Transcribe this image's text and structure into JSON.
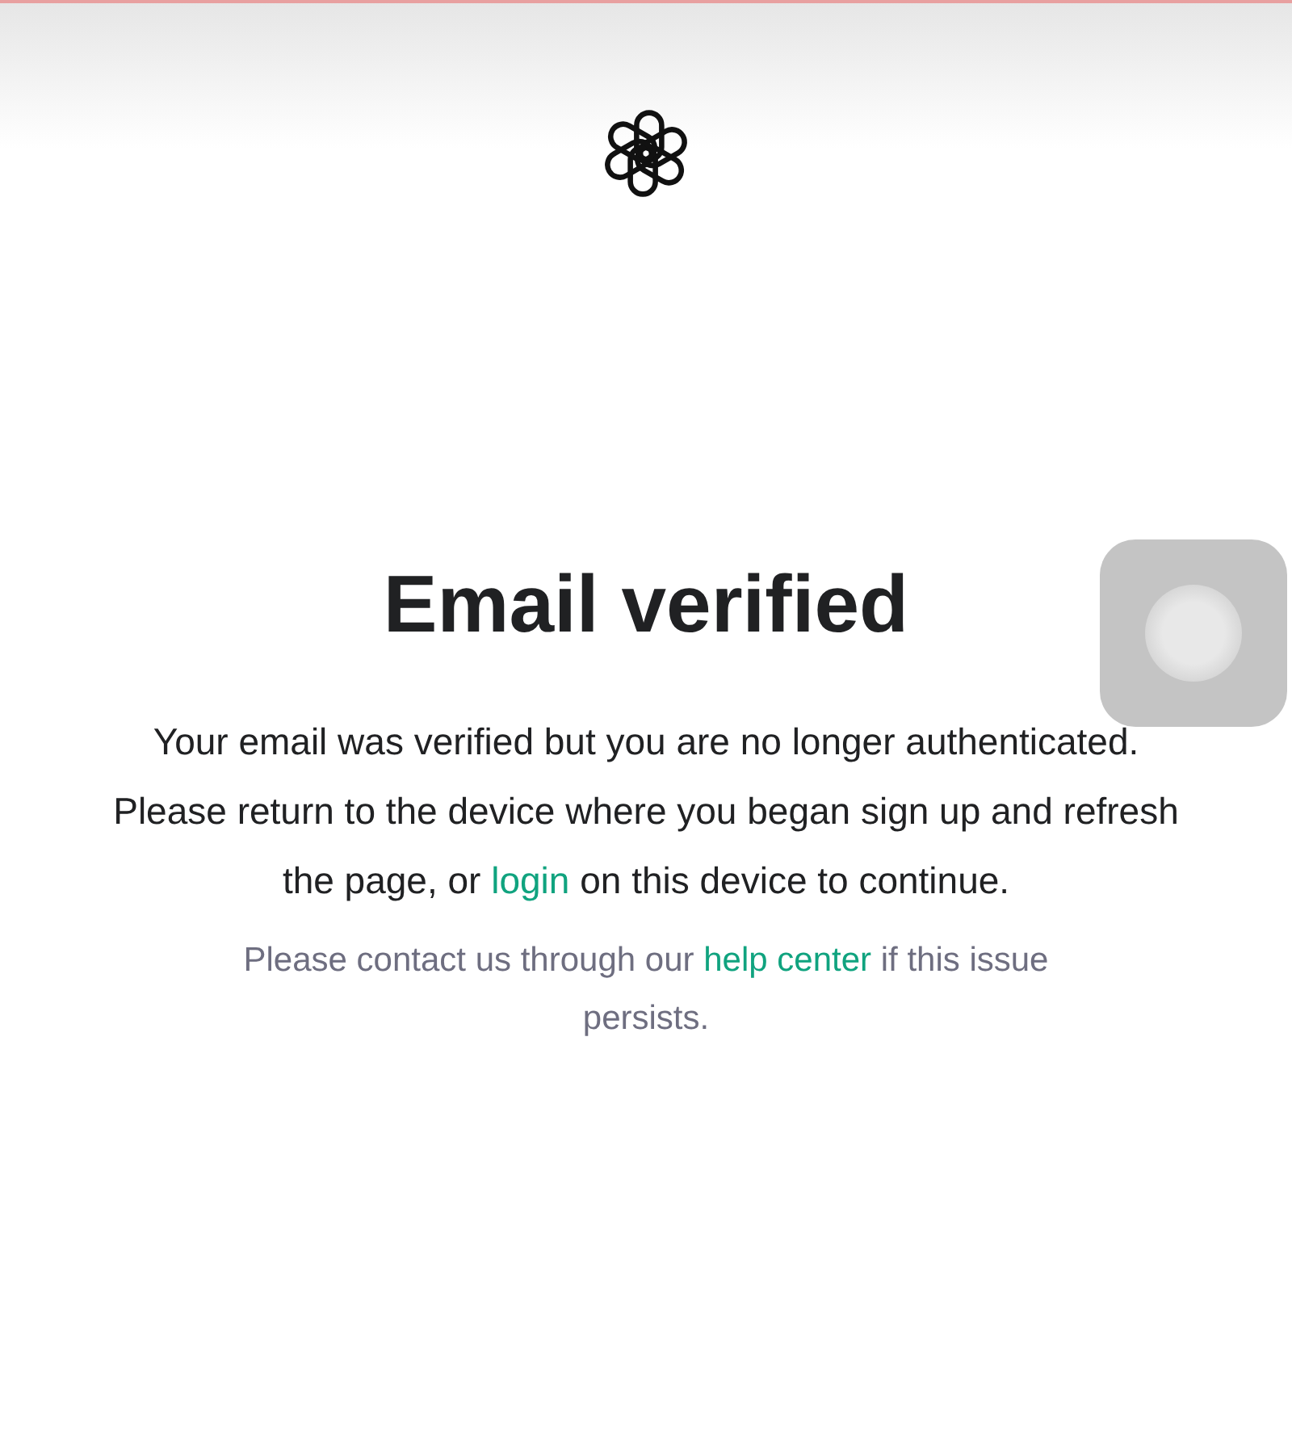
{
  "heading": "Email verified",
  "message": {
    "before": "Your email was verified but you are no longer authenticated. Please return to the device where you began sign up and refresh the page, or",
    "link": "login",
    "after": "on this device to continue."
  },
  "help": {
    "before": "Please contact us through our",
    "link": "help center",
    "after": "if this issue persists."
  }
}
